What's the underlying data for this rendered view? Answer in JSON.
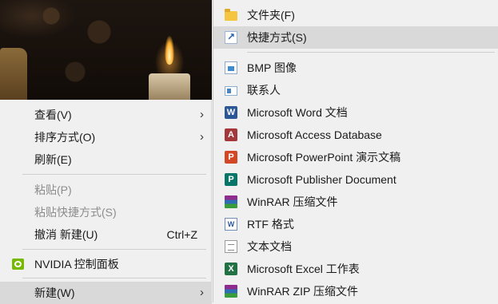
{
  "context_menu": {
    "items": [
      {
        "label": "查看(V)",
        "has_submenu": true
      },
      {
        "label": "排序方式(O)",
        "has_submenu": true
      },
      {
        "label": "刷新(E)"
      },
      {
        "label": "粘贴(P)",
        "disabled": true
      },
      {
        "label": "粘贴快捷方式(S)",
        "disabled": true
      },
      {
        "label": "撤消 新建(U)",
        "shortcut": "Ctrl+Z"
      },
      {
        "label": "NVIDIA 控制面板",
        "icon": "nvidia-icon"
      },
      {
        "label": "新建(W)",
        "has_submenu": true,
        "highlighted": true
      }
    ],
    "submenu_arrow": "›"
  },
  "new_submenu": {
    "items": [
      {
        "label": "文件夹(F)",
        "icon": "folder-icon"
      },
      {
        "label": "快捷方式(S)",
        "icon": "shortcut-icon",
        "highlighted": true
      },
      {
        "label": "BMP 图像",
        "icon": "bmp-image-icon"
      },
      {
        "label": "联系人",
        "icon": "contact-icon"
      },
      {
        "label": "Microsoft Word 文档",
        "icon": "word-icon",
        "glyph": "W"
      },
      {
        "label": "Microsoft Access Database",
        "icon": "access-icon",
        "glyph": "A"
      },
      {
        "label": "Microsoft PowerPoint 演示文稿",
        "icon": "powerpoint-icon",
        "glyph": "P"
      },
      {
        "label": "Microsoft Publisher Document",
        "icon": "publisher-icon",
        "glyph": "P"
      },
      {
        "label": "WinRAR 压缩文件",
        "icon": "winrar-icon"
      },
      {
        "label": "RTF 格式",
        "icon": "rtf-icon",
        "glyph": "W"
      },
      {
        "label": "文本文档",
        "icon": "text-document-icon"
      },
      {
        "label": "Microsoft Excel 工作表",
        "icon": "excel-icon",
        "glyph": "X"
      },
      {
        "label": "WinRAR ZIP 压缩文件",
        "icon": "winrar-zip-icon"
      }
    ]
  },
  "colors": {
    "menu_background": "#f0f0f0",
    "highlight": "#d9d9d9",
    "disabled_text": "#8c8c8c"
  }
}
